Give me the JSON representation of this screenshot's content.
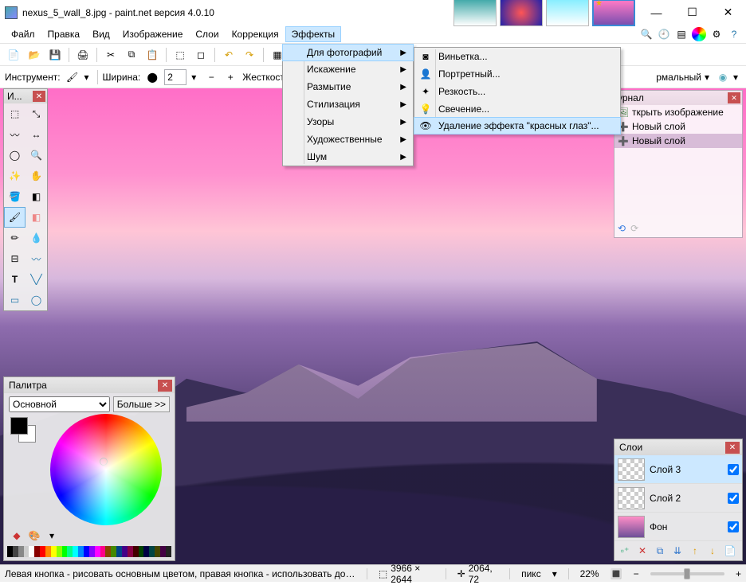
{
  "titlebar": {
    "title": "nexus_5_wall_8.jpg - paint.net версия 4.0.10"
  },
  "menu": {
    "items": [
      "Файл",
      "Правка",
      "Вид",
      "Изображение",
      "Слои",
      "Коррекция",
      "Эффекты"
    ],
    "open_index": 6
  },
  "effects_menu": [
    {
      "label": "Для фотографий",
      "hl": true
    },
    {
      "label": "Искажение"
    },
    {
      "label": "Размытие"
    },
    {
      "label": "Стилизация"
    },
    {
      "label": "Узоры"
    },
    {
      "label": "Художественные"
    },
    {
      "label": "Шум"
    }
  ],
  "photo_submenu": [
    {
      "label": "Виньетка..."
    },
    {
      "label": "Портретный..."
    },
    {
      "label": "Резкость..."
    },
    {
      "label": "Свечение..."
    },
    {
      "label": "Удаление эффекта \"красных глаз\"...",
      "hl": true
    }
  ],
  "optbar": {
    "tool_label": "Инструмент:",
    "width_label": "Ширина:",
    "width_value": "2",
    "hardness_label": "Жесткость:",
    "blend_value": "рмальный"
  },
  "tools_panel": {
    "title": "И..."
  },
  "history": {
    "title": "урнал",
    "items": [
      {
        "label": "ткрыть изображение"
      },
      {
        "label": "Новый слой"
      },
      {
        "label": "Новый слой",
        "sel": true
      }
    ]
  },
  "palette": {
    "title": "Палитра",
    "mode": "Основной",
    "more": "Больше >>"
  },
  "layers": {
    "title": "Слои",
    "items": [
      {
        "name": "Слой 3",
        "checked": true,
        "sel": true,
        "checker": true
      },
      {
        "name": "Слой 2",
        "checked": true,
        "checker": true
      },
      {
        "name": "Фон",
        "checked": true,
        "checker": false
      }
    ]
  },
  "status": {
    "hint": "Левая кнопка - рисовать основным цветом, правая кнопка - использовать дополнительным цветом.",
    "dims": "3966 × 2644",
    "cursor": "2064, 72",
    "unit": "пикс",
    "zoom": "22%"
  }
}
